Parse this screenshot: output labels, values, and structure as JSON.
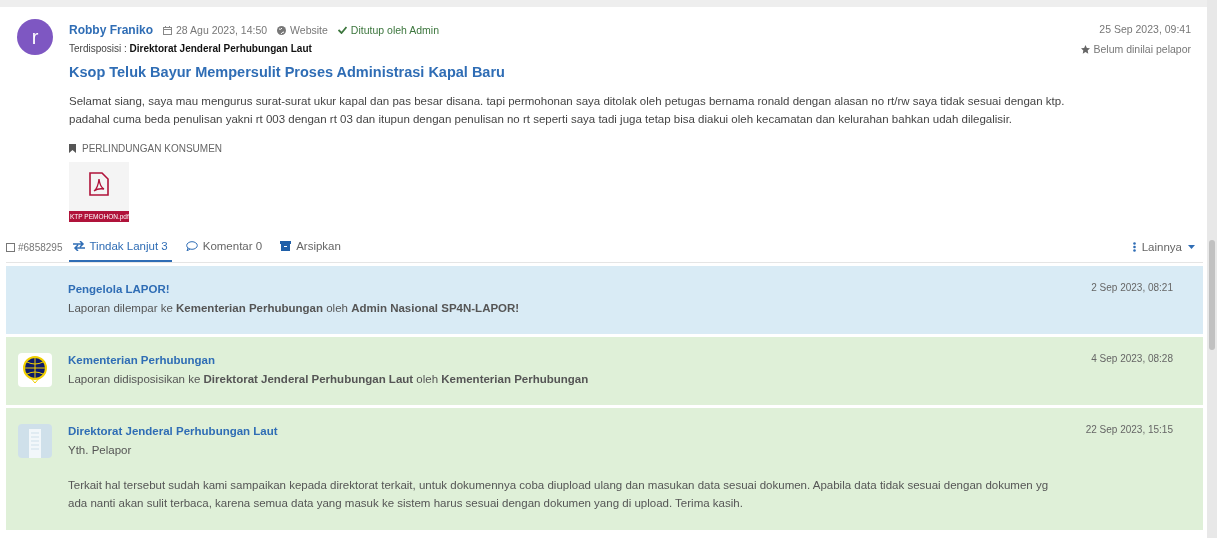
{
  "report": {
    "avatar_letter": "r",
    "author": "Robby Franiko",
    "date": "28 Agu 2023, 14:50",
    "channel": "Website",
    "status": "Ditutup oleh Admin",
    "disposition_label": "Terdisposisi :",
    "disposition_target": "Direktorat Jenderal Perhubungan Laut",
    "updated": "25 Sep 2023, 09:41",
    "rating": "Belum dinilai pelapor",
    "title": "Ksop Teluk Bayur Mempersulit Proses Administrasi Kapal Baru",
    "body": "Selamat siang, saya mau mengurus surat-surat ukur kapal dan pas besar disana. tapi permohonan saya ditolak oleh petugas bernama ronald dengan alasan no rt/rw saya tidak sesuai dengan ktp. padahal cuma beda penulisan yakni rt 003 dengan rt 03 dan itupun dengan penulisan no rt seperti saya tadi juga tetap bisa diakui oleh kecamatan dan kelurahan bahkan udah dilegalisir.",
    "category": "PERLINDUNGAN KONSUMEN",
    "attachment": "KTP PEMOHON.pdf"
  },
  "tabs_bar": {
    "id": "#6858295",
    "tabs": [
      {
        "kind": "followup",
        "label": "Tindak Lanjut 3",
        "selected": true
      },
      {
        "kind": "comment",
        "label": "Komentar 0",
        "selected": false
      },
      {
        "kind": "archive",
        "label": "Arsipkan",
        "selected": false
      }
    ],
    "more": "Lainnya"
  },
  "timeline": [
    {
      "kind": "admin",
      "name": "Pengelola LAPOR!",
      "time": "2 Sep 2023, 08:21",
      "lines": [
        "Laporan dilempar ke **Kementerian Perhubungan** oleh **Admin Nasional SP4N-LAPOR!**"
      ]
    },
    {
      "kind": "ministry",
      "name": "Kementerian Perhubungan",
      "time": "4 Sep 2023, 08:28",
      "lines": [
        "Laporan didisposisikan ke **Direktorat Jenderal Perhubungan Laut** oleh **Kementerian Perhubungan**"
      ]
    },
    {
      "kind": "agency",
      "name": "Direktorat Jenderal Perhubungan Laut",
      "time": "22 Sep 2023, 15:15",
      "lines": [
        "Yth. Pelapor",
        "Terkait hal tersebut sudah kami sampaikan kepada direktorat terkait, untuk dokumennya coba diupload ulang dan masukan data sesuai dokumen. Apabila data tidak sesuai dengan dokumen yg ada nanti akan sulit terbaca, karena semua data yang masuk ke sistem harus sesuai dengan dokumen yang di upload. Terima kasih."
      ]
    }
  ]
}
